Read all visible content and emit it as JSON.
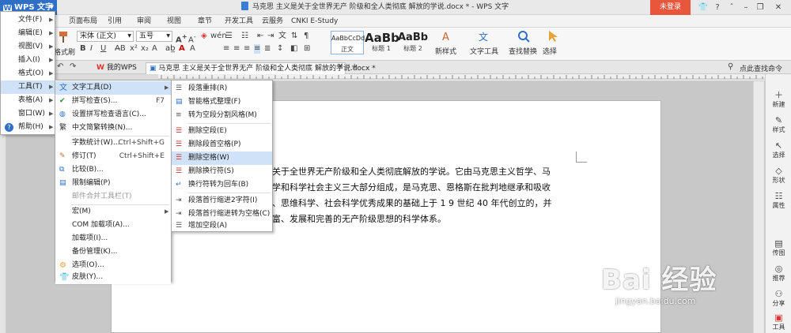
{
  "app": {
    "name": "WPS 文字",
    "doc_title": "马克思 主义是关于全世界无产 阶级和全人类彻底 解放的学说.docx * - WPS 文字",
    "login_label": "未登录"
  },
  "ribbon_tabs": [
    "页面布局",
    "引用",
    "审阅",
    "视图",
    "章节",
    "开发工具",
    "云服务",
    "CNKI E-Study"
  ],
  "ribbon": {
    "font_name": "宋体 (正文)",
    "font_size": "五号",
    "format_painter": "格式刷",
    "style_normal_sample": "AaBbCcDd",
    "style_normal_label": "正文",
    "style_h1_sample": "AaBb",
    "style_h1_label": "标题 1",
    "style_h2_sample": "AaBb(",
    "style_h2_label": "标题 2",
    "new_style": "新样式",
    "text_tools": "文字工具",
    "find_replace": "查找替换",
    "select": "选择"
  },
  "doc_tabs": {
    "my_wps": "我的WPS",
    "doc": "马克思 主义是关于全世界无产 阶级和全人类彻底 解放的学说.docx *",
    "expand_hint": "点此查找命令"
  },
  "main_menu": [
    {
      "label": "文件(F)",
      "sub": true
    },
    {
      "label": "编辑(E)",
      "sub": true
    },
    {
      "label": "视图(V)",
      "sub": true
    },
    {
      "label": "插入(I)",
      "sub": true
    },
    {
      "label": "格式(O)",
      "sub": true
    },
    {
      "label": "工具(T)",
      "sub": true
    },
    {
      "label": "表格(A)",
      "sub": true
    },
    {
      "label": "窗口(W)",
      "sub": true
    },
    {
      "label": "帮助(H)",
      "sub": true
    }
  ],
  "tools_menu": [
    {
      "label": "文字工具(D)",
      "shortcut": "",
      "icon": "text-tools-icon",
      "sub": true
    },
    {
      "label": "拼写检查(S)...",
      "shortcut": "F7",
      "icon": "spellcheck-icon"
    },
    {
      "label": "设置拼写检查语言(C)...",
      "shortcut": "",
      "icon": "spell-language-icon"
    },
    {
      "label": "中文简繁转换(N)...",
      "shortcut": "",
      "icon": "simp-trad-icon"
    },
    {
      "label": "字数统计(W)...",
      "shortcut": "Ctrl+Shift+G",
      "icon": ""
    },
    {
      "label": "修订(T)",
      "shortcut": "Ctrl+Shift+E",
      "icon": "revise-icon"
    },
    {
      "label": "比较(B)...",
      "shortcut": "",
      "icon": "compare-icon"
    },
    {
      "label": "限制编辑(P)",
      "shortcut": "",
      "icon": "restrict-edit-icon"
    },
    {
      "label": "邮件合并工具栏(T)",
      "shortcut": "",
      "icon": "",
      "disabled": true
    },
    {
      "label": "宏(M)",
      "shortcut": "",
      "icon": "",
      "sub": true
    },
    {
      "label": "COM 加载项(A)...",
      "shortcut": "",
      "icon": ""
    },
    {
      "label": "加载项(I)...",
      "shortcut": "",
      "icon": ""
    },
    {
      "label": "备份管理(K)...",
      "shortcut": "",
      "icon": ""
    },
    {
      "label": "选项(O)...",
      "shortcut": "",
      "icon": "options-icon"
    },
    {
      "label": "皮肤(Y)...",
      "shortcut": "",
      "icon": "skin-icon"
    }
  ],
  "text_tools_menu": [
    {
      "label": "段落重排(R)"
    },
    {
      "label": "智能格式整理(F)"
    },
    {
      "label": "转为空段分割风格(M)"
    },
    {
      "label": "删除空段(E)"
    },
    {
      "label": "删除段首空格(P)"
    },
    {
      "label": "删除空格(W)"
    },
    {
      "label": "删除换行符(S)"
    },
    {
      "label": "换行符转为回车(B)"
    },
    {
      "label": "段落首行缩进2字符(I)"
    },
    {
      "label": "段落首行缩进转为空格(C)"
    },
    {
      "label": "增加空段(A)"
    }
  ],
  "document": {
    "paragraph": "关于全世界无产阶级和全人类彻底解放的学说。它由马克思主义哲学、马 学和科学社会主义三大部分组成，是马克思、恩格斯在批判地继承和吸收 、思维科学、社会科学优秀成果的基础上于 1 9 世纪 40 年代创立的，并 富、发展和完善的无产阶级思想的科学体系。",
    "lines": [
      "关于全世界无产阶级和全人类彻底解放的学说。它由马克思主义哲学、马",
      "学和科学社会主义三大部分组成，是马克思、恩格斯在批判地继承和吸收",
      "、思维科学、社会科学优秀成果的基础上于 1 9 世纪 40 年代创立的，并",
      "富、发展和完善的无产阶级思想的科学体系。"
    ]
  },
  "right_sidebar": [
    {
      "label": "新建",
      "icon": "new-icon"
    },
    {
      "label": "样式",
      "icon": "style-icon"
    },
    {
      "label": "选择",
      "icon": "select-icon"
    },
    {
      "label": "形状",
      "icon": "shape-icon"
    },
    {
      "label": "属性",
      "icon": "property-icon"
    },
    {
      "label": "传图",
      "icon": "image-upload-icon"
    },
    {
      "label": "推荐",
      "icon": "recommend-icon"
    },
    {
      "label": "分享",
      "icon": "share-icon"
    },
    {
      "label": "工具",
      "icon": "toolbox-icon"
    }
  ],
  "watermark": {
    "logo": "Bai 经验",
    "url": "jingyan.baidu.com"
  },
  "colors": {
    "wps_blue": "#2f6fc6",
    "login_red": "#e8563c",
    "menu_highlight": "#cfe2f7"
  }
}
